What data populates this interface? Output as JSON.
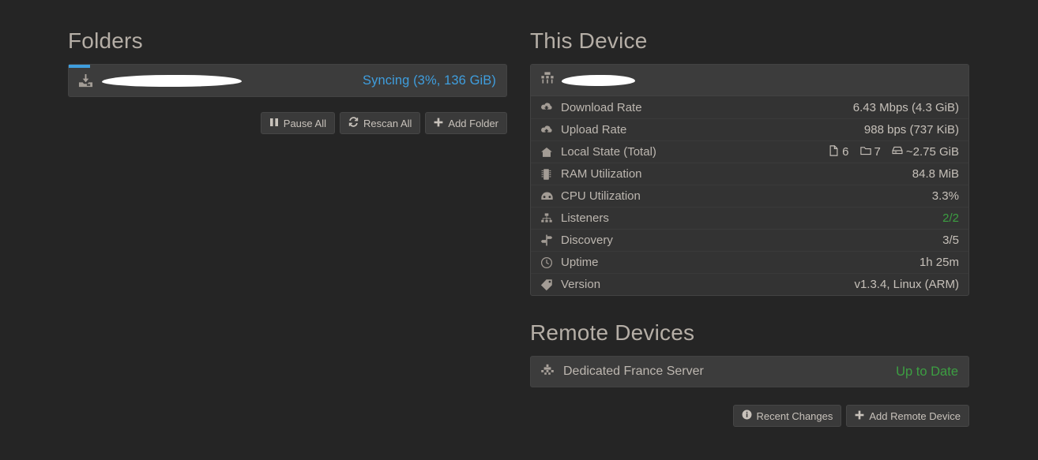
{
  "folders": {
    "section_title": "Folders",
    "items": [
      {
        "name_redacted": true,
        "icon": "folder-download-icon",
        "status": "Syncing (3%, 136 GiB)",
        "progress_percent": 3,
        "size": "136 GiB",
        "status_color": "#3f9ede"
      }
    ],
    "buttons": [
      {
        "label": "Pause All",
        "icon": "pause-icon",
        "name": "pause-all-button"
      },
      {
        "label": "Rescan All",
        "icon": "refresh-icon",
        "name": "rescan-all-button"
      },
      {
        "label": "Add Folder",
        "icon": "plus-icon",
        "name": "add-folder-button"
      }
    ]
  },
  "this_device": {
    "section_title": "This Device",
    "header": {
      "icon": "sitemap-icon",
      "name_redacted": true
    },
    "stats": [
      {
        "icon": "cloud-download-icon",
        "label": "Download Rate",
        "value": "6.43 Mbps (4.3 GiB)"
      },
      {
        "icon": "cloud-upload-icon",
        "label": "Upload Rate",
        "value": "988 bps (737 KiB)"
      },
      {
        "icon": "home-icon",
        "label": "Local State (Total)",
        "value": "",
        "local_state": {
          "files": "6",
          "folders": "7",
          "size": "~2.75 GiB"
        }
      },
      {
        "icon": "memory-icon",
        "label": "RAM Utilization",
        "value": "84.8 MiB"
      },
      {
        "icon": "gauge-icon",
        "label": "CPU Utilization",
        "value": "3.3%"
      },
      {
        "icon": "sitemap-icon",
        "label": "Listeners",
        "value": "2/2",
        "value_color": "#3c9e42"
      },
      {
        "icon": "signpost-icon",
        "label": "Discovery",
        "value": "3/5"
      },
      {
        "icon": "clock-icon",
        "label": "Uptime",
        "value": "1h 25m"
      },
      {
        "icon": "tag-icon",
        "label": "Version",
        "value": "v1.3.4, Linux (ARM)"
      }
    ]
  },
  "remote_devices": {
    "section_title": "Remote Devices",
    "items": [
      {
        "icon": "plug-icon",
        "name": "Dedicated France Server",
        "status": "Up to Date",
        "status_color": "#3c9e42"
      }
    ],
    "buttons": [
      {
        "label": "Recent Changes",
        "icon": "info-icon",
        "name": "recent-changes-button"
      },
      {
        "label": "Add Remote Device",
        "icon": "plus-icon",
        "name": "add-remote-device-button"
      }
    ]
  },
  "colors": {
    "background": "#252525",
    "panel": "#333333",
    "panel_header": "#3c3c3c",
    "accent_blue": "#3f9ede",
    "accent_green": "#3c9e42",
    "text": "#bdb7b0",
    "heading": "#b5aea6"
  }
}
